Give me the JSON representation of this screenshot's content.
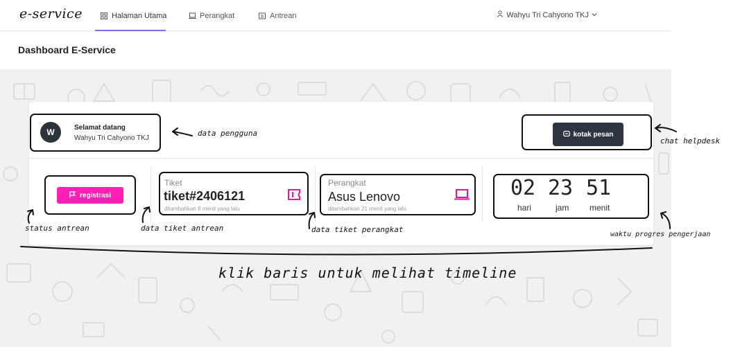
{
  "app": {
    "brand": "e-service"
  },
  "nav": {
    "items": [
      {
        "label": "Halaman Utama",
        "icon": "grid-icon",
        "active": true
      },
      {
        "label": "Perangkat",
        "icon": "laptop-icon",
        "active": false
      },
      {
        "label": "Antrean",
        "icon": "queue-icon",
        "active": false
      }
    ],
    "user": "Wahyu Tri Cahyono TKJ"
  },
  "page": {
    "title": "Dashboard E-Service"
  },
  "profile": {
    "avatar_letter": "W",
    "greeting": "Selamat datang",
    "name": "Wahyu Tri Cahyono TKJ"
  },
  "chat": {
    "button_label": "kotak pesan",
    "icon": "chat-icon"
  },
  "queue_status": {
    "button_label": "registrasi",
    "icon": "flag-icon",
    "color": "#ff1fb4"
  },
  "ticket": {
    "label": "Tiket",
    "value": "tiket#2406121",
    "sub": "ditambahkan 8 menit yang lalu",
    "icon": "ticket-icon",
    "accent": "#e0199c"
  },
  "device": {
    "label": "Perangkat",
    "value": "Asus Lenovo",
    "sub": "ditambahkan 21 menit yang lalu",
    "icon": "laptop-icon",
    "accent": "#e0199c"
  },
  "timer": {
    "days": "02",
    "hours": "23",
    "minutes": "51",
    "days_label": "hari",
    "hours_label": "jam",
    "minutes_label": "menit"
  },
  "annotations": {
    "user_data": "data pengguna",
    "chat": "chat helpdesk",
    "queue_status": "status antrean",
    "ticket_data": "data tiket antrean",
    "device_data": "data tiket perangkat",
    "progress": "waktu progres pengerjaan",
    "timeline": "klik baris untuk melihat timeline"
  }
}
